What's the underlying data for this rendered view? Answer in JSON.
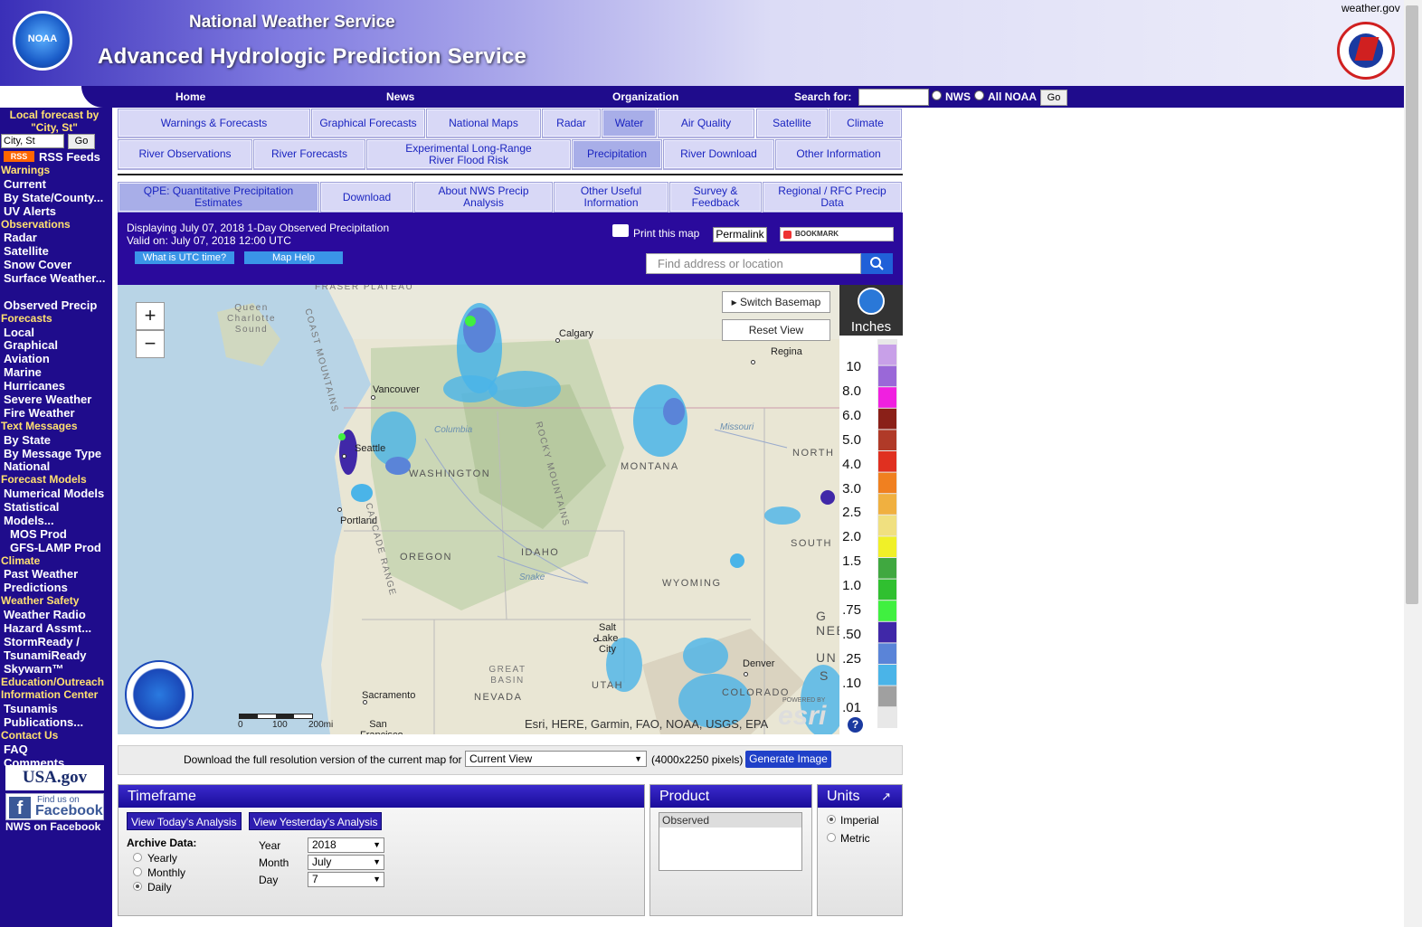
{
  "header": {
    "org": "National Weather Service",
    "title": "Advanced Hydrologic Prediction Service",
    "site": "weather.gov",
    "noaa_logo_text": "NOAA"
  },
  "topnav": {
    "home": "Home",
    "news": "News",
    "organization": "Organization",
    "search_label": "Search for:",
    "search_value": "",
    "opt_nws": "NWS",
    "opt_all": "All NOAA",
    "go": "Go"
  },
  "sidebar": {
    "local_label": "Local forecast by \"City, St\"",
    "local_placeholder": "City, St",
    "go": "Go",
    "rss_badge": "RSS",
    "rss": "RSS Feeds",
    "sections": [
      {
        "title": "Warnings",
        "items": [
          "Current",
          "By State/County...",
          "UV Alerts"
        ]
      },
      {
        "title": "Observations",
        "items": [
          "Radar",
          "Satellite",
          "Snow Cover",
          "Surface Weather...",
          "Observed Precip"
        ]
      },
      {
        "title": "Forecasts",
        "items": [
          "Local",
          "Graphical",
          "Aviation",
          "Marine",
          "Hurricanes",
          "Severe Weather",
          "Fire Weather"
        ]
      },
      {
        "title": "Text Messages",
        "items": [
          "By State",
          "By Message Type",
          "National"
        ]
      },
      {
        "title": "Forecast Models",
        "items": [
          "Numerical Models",
          "Statistical Models...",
          "MOS Prod",
          "GFS-LAMP Prod"
        ]
      },
      {
        "title": "Climate",
        "items": [
          "Past Weather",
          "Predictions"
        ]
      },
      {
        "title": "Weather Safety",
        "items": [
          "Weather Radio",
          "Hazard Assmt...",
          "StormReady /",
          "TsunamiReady",
          "Skywarn™"
        ]
      },
      {
        "title": "Education/Outreach",
        "items": []
      },
      {
        "title": "Information Center",
        "items": [
          "Tsunamis",
          "Publications..."
        ]
      },
      {
        "title": "Contact Us",
        "items": [
          "FAQ",
          "Comments..."
        ]
      }
    ],
    "usagov": "USA.gov",
    "fb_line1": "Find us on",
    "fb_line2": "Facebook",
    "fb_caption": "NWS on Facebook"
  },
  "tabs_row1": [
    "Warnings & Forecasts",
    "Graphical Forecasts",
    "National Maps",
    "Radar",
    "Water",
    "Air Quality",
    "Satellite",
    "Climate"
  ],
  "tabs_row2": [
    "River Observations",
    "River Forecasts",
    "Experimental Long-Range River Flood Risk",
    "Precipitation",
    "River Download",
    "Other Information"
  ],
  "tabs_row3": [
    "QPE: Quantitative Precipitation Estimates",
    "Download",
    "About NWS Precip Analysis",
    "Other Useful Information",
    "Survey & Feedback",
    "Regional / RFC Precip Data"
  ],
  "info": {
    "line1": "Displaying July 07, 2018 1-Day Observed Precipitation",
    "line2": "Valid on: July 07, 2018 12:00 UTC",
    "utc_btn": "What is UTC time?",
    "help_btn": "Map Help",
    "print": "Print this map",
    "permalink": "Permalink",
    "bookmark": "BOOKMARK",
    "find_placeholder": "Find address or location"
  },
  "map": {
    "zoom_in": "+",
    "zoom_out": "−",
    "switch_basemap": "Switch Basemap",
    "reset_view": "Reset View",
    "attribution": "Esri, HERE, Garmin, FAO, NOAA, USGS, EPA",
    "esri": "esri",
    "powered_by": "POWERED BY",
    "scale": [
      "0",
      "100",
      "200mi"
    ],
    "cities": [
      "Calgary",
      "Regina",
      "Vancouver",
      "Seattle",
      "Portland",
      "Salt Lake City",
      "Denver",
      "Sacramento",
      "San Francisco"
    ],
    "states": [
      "WASHINGTON",
      "OREGON",
      "IDAHO",
      "MONTANA",
      "WYOMING",
      "NEVADA",
      "UTAH",
      "COLORADO",
      "NORTH",
      "SOUTH",
      "UN",
      "S",
      "G",
      "NEB"
    ],
    "regions": [
      "FRASER PLATEAU",
      "Queen Charlotte Sound",
      "Columbia",
      "Snake",
      "Missouri",
      "GREAT BASIN",
      "CASCADE RANGE",
      "ROCKY MOUNTAINS",
      "COAST MOUNTAINS"
    ]
  },
  "legend": {
    "units": "Inches",
    "labels": [
      "10",
      "8.0",
      "6.0",
      "5.0",
      "4.0",
      "3.0",
      "2.5",
      "2.0",
      "1.5",
      "1.0",
      ".75",
      ".50",
      ".25",
      ".10",
      ".01"
    ],
    "colors": [
      "#c8a0e8",
      "#9a68d8",
      "#f020e0",
      "#8a2018",
      "#b03a28",
      "#e03020",
      "#f08020",
      "#f0b040",
      "#f0e080",
      "#f0f028",
      "#40a840",
      "#30c030",
      "#40f040",
      "#4028a8",
      "#5a84d8",
      "#4ab4e8",
      "#a0a0a0"
    ]
  },
  "download": {
    "label": "Download the full resolution version of the current map for",
    "select": "Current View",
    "size": "(4000x2250 pixels)",
    "button": "Generate Image"
  },
  "timeframe": {
    "title": "Timeframe",
    "today": "View Today's Analysis",
    "yesterday": "View Yesterday's Analysis",
    "archive": "Archive Data:",
    "yearly": "Yearly",
    "monthly": "Monthly",
    "daily": "Daily",
    "year_lbl": "Year",
    "month_lbl": "Month",
    "day_lbl": "Day",
    "year": "2018",
    "month": "July",
    "day": "7"
  },
  "product": {
    "title": "Product",
    "selected": "Observed"
  },
  "units": {
    "title": "Units",
    "imperial": "Imperial",
    "metric": "Metric"
  }
}
